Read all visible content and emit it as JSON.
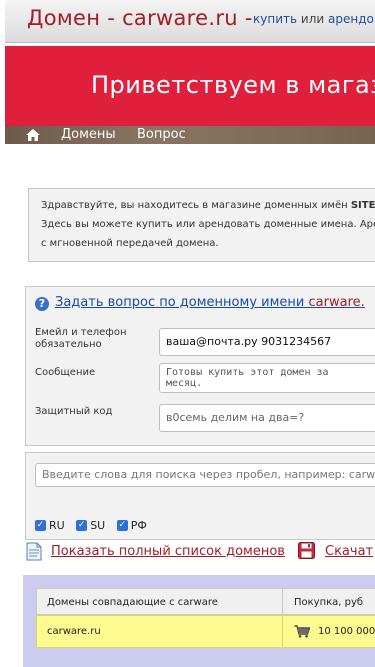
{
  "header": {
    "site_name": "Домен - carware.ru -",
    "tagline_buy": "купить",
    "tagline_or": "или",
    "tagline_rent": "арендова"
  },
  "banner": {
    "text": "Приветствуем в магаз"
  },
  "nav": {
    "items": [
      "Домены",
      "Вопрос"
    ]
  },
  "welcome": {
    "line1_pre": "Здравствуйте, вы находитесь в магазине доменных имён ",
    "line1_bold": "SITE.s",
    "line2": "Здесь вы можете купить или арендовать доменные имена. Аренд",
    "line3": "с мгновенной передачей домена."
  },
  "question": {
    "title": "Задать вопрос по доменному имени ",
    "domain": "carware.",
    "contact_label": "Емейл и телефон обязательно",
    "contact_value": "ваша@почта.ру 9031234567",
    "message_label": "Сообщение",
    "message_line1": "Готовы купить этот домен за",
    "message_line2": "месяц.",
    "captcha_label": "Защитный код",
    "captcha_placeholder": "в0семь делим на два=?"
  },
  "search": {
    "placeholder": "Введите слова для поиска через пробел, например: carware",
    "zones": [
      {
        "label": "RU",
        "checked": true
      },
      {
        "label": "SU",
        "checked": true
      },
      {
        "label": "РФ",
        "checked": true
      }
    ]
  },
  "links": {
    "full_list": "Показать полный список доменов",
    "download": "Скачат"
  },
  "results": {
    "col_domain": "Домены совпадающие с carware",
    "col_price": "Покупка, руб",
    "rows": [
      {
        "domain": "carware.ru",
        "price": "10 100 000"
      }
    ]
  },
  "colors": {
    "brand_red": "#a31d24",
    "banner_red": "#df1f3c",
    "link_blue": "#1a4aa8",
    "highlight_row": "#fffb91",
    "results_bg": "#ccccee"
  },
  "icons": [
    "home-icon",
    "question-icon",
    "document-icon",
    "save-icon",
    "cart-icon",
    "checkbox-checked-icon"
  ]
}
